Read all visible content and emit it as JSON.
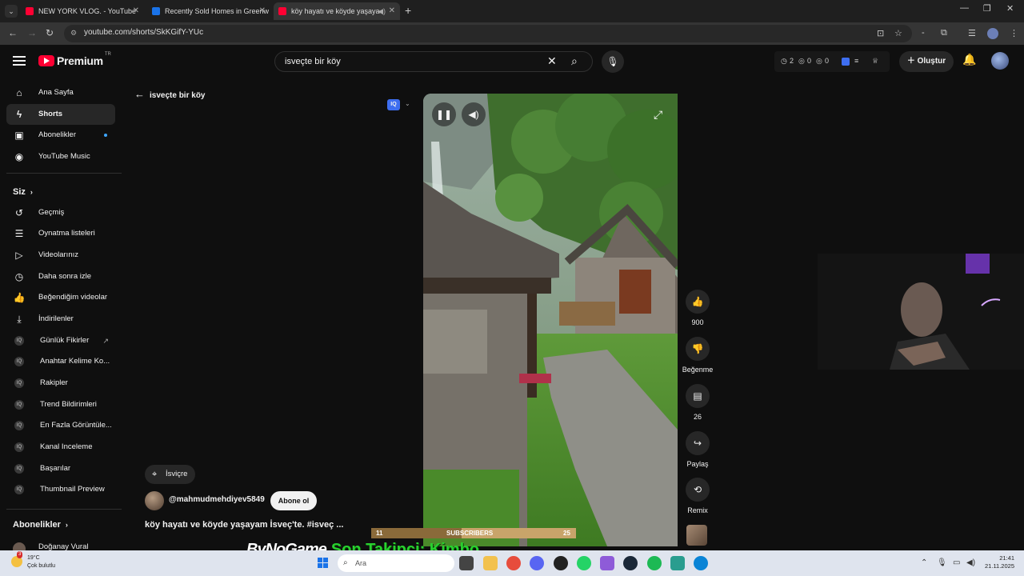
{
  "browser": {
    "tabs": [
      {
        "title": "NEW YORK VLOG. - YouTube",
        "favicon_color": "#ff0033"
      },
      {
        "title": "Recently Sold Homes in Greenw",
        "favicon_color": "#1a73e8"
      },
      {
        "title": "köy hayatı ve köyde yaşaya",
        "favicon_color": "#ff0033"
      }
    ],
    "url": "youtube.com/shorts/SkKGifY-YUc"
  },
  "header": {
    "logo_text": "Premium",
    "logo_region": "TR",
    "search_value": "isveçte bir köy",
    "ext_counts": [
      "2",
      "0",
      "0"
    ],
    "create_label": "Oluştur"
  },
  "sidebar": {
    "items": [
      {
        "label": "Ana Sayfa",
        "icon": "home-icon"
      },
      {
        "label": "Shorts",
        "icon": "shorts-icon"
      },
      {
        "label": "Abonelikler",
        "icon": "subscriptions-icon"
      },
      {
        "label": "YouTube Music",
        "icon": "music-icon"
      }
    ],
    "you_heading": "Siz",
    "you_items": [
      {
        "label": "Geçmiş",
        "icon": "history-icon"
      },
      {
        "label": "Oynatma listeleri",
        "icon": "playlist-icon"
      },
      {
        "label": "Videolarınız",
        "icon": "your-videos-icon"
      },
      {
        "label": "Daha sonra izle",
        "icon": "clock-icon"
      },
      {
        "label": "Beğendiğim videolar",
        "icon": "like-icon"
      },
      {
        "label": "İndirilenler",
        "icon": "download-icon"
      }
    ],
    "tool_items": [
      {
        "label": "Günlük Fikirler"
      },
      {
        "label": "Anahtar Kelime Ko..."
      },
      {
        "label": "Rakipler"
      },
      {
        "label": "Trend Bildirimleri"
      },
      {
        "label": "En Fazla Görüntüle..."
      },
      {
        "label": "Kanal Inceleme"
      },
      {
        "label": "Başarılar"
      },
      {
        "label": "Thumbnail Preview"
      }
    ],
    "subs_heading": "Abonelikler",
    "sub_channel": "Doğanay Vural"
  },
  "main": {
    "back_label": "isveçte bir köy",
    "iq_label": "IQ",
    "location_chip": "İsviçre",
    "channel": "@mahmudmehdiyev5849",
    "subscribe_label": "Abone ol",
    "title": "köy hayatı ve köyde yaşayam İsveç'te. #isveç ...",
    "actions": {
      "likes": "900",
      "dislike_label": "Beğenme",
      "comments": "26",
      "share_label": "Paylaş",
      "remix_label": "Remix"
    }
  },
  "overlay": {
    "sub_current": "11",
    "sub_label": "SUBSCRIBERS",
    "sub_goal": "25",
    "sub_progress": 0.44,
    "brand": "ByNoGame",
    "follower_text": "Son Takipçi: Kimbo..."
  },
  "taskbar": {
    "weather_temp": "19°C",
    "weather_desc": "Çok bulutlu",
    "weather_badge": "3",
    "search_placeholder": "Ara",
    "time": "21:41",
    "date": "21.11.2025"
  }
}
